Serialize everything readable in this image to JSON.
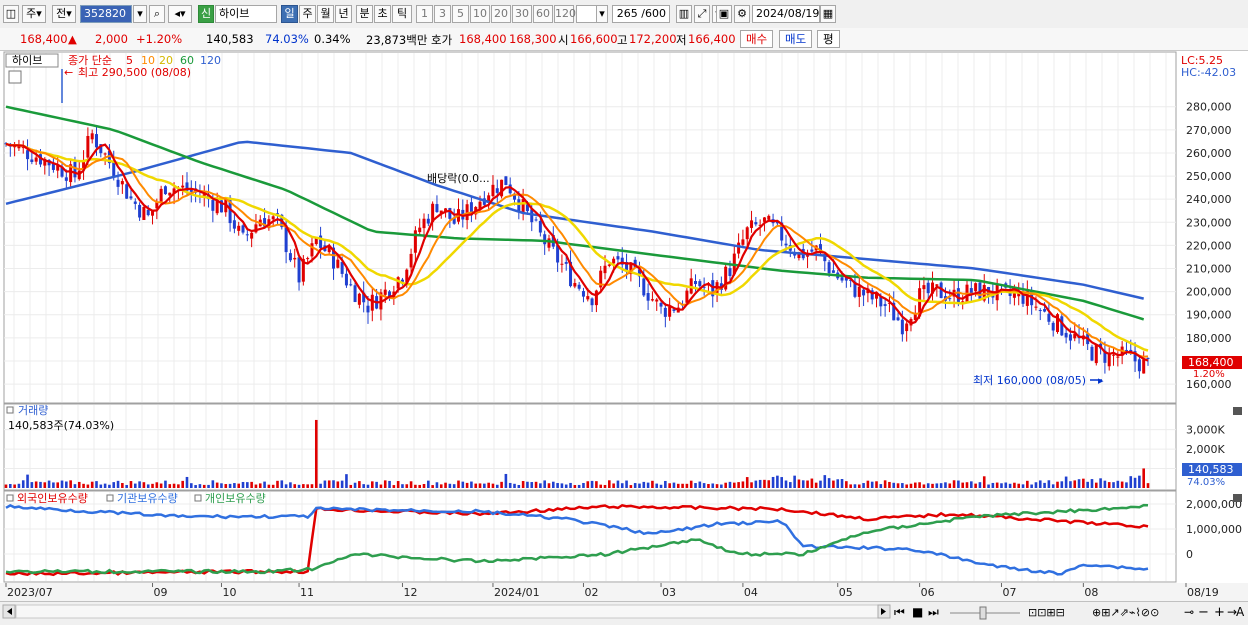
{
  "toolbar": {
    "period_main": "주",
    "code_label": "전",
    "stock_code": "352820",
    "name_badge": "신",
    "stock_name": "하이브",
    "periods": [
      "일",
      "주",
      "월",
      "년",
      "분",
      "초",
      "틱"
    ],
    "active_period": "일",
    "counts": [
      "1",
      "3",
      "5",
      "10",
      "20",
      "30",
      "60",
      "120"
    ],
    "range_text": "265 /600",
    "date": "2024/08/19"
  },
  "price_bar": {
    "price": "168,400",
    "change": "2,000",
    "change_pct": "+1.20%",
    "volume": "140,583",
    "volume_pct": "74.03%",
    "turnover_pct": "0.34%",
    "amount": "23,873백만",
    "hoga_label": "호가",
    "ask": "168,400",
    "bid": "168,300",
    "open_label": "시",
    "open": "166,600",
    "high_label": "고",
    "high": "172,200",
    "low_label": "저",
    "low": "166,400",
    "buy_label": "매수",
    "sell_label": "매도",
    "avg_label": "평"
  },
  "legend": {
    "name": "하이브",
    "ma_label": "종가 단순",
    "ma_periods": [
      "5",
      "10",
      "20",
      "60",
      "120"
    ],
    "ma_colors": [
      "#e00000",
      "#ff8a00",
      "#f0d800",
      "#1a9a3a",
      "#2f5fd0"
    ],
    "lc": "LC:5.25",
    "hc": "HC:-42.03"
  },
  "annotations": {
    "high_marker": "최고 290,500 (08/08)",
    "low_marker": "최저 160,000 (08/05)",
    "dividend": "배당락(0.0...",
    "current_tag": "168,400",
    "current_tag_pct": "1.20%"
  },
  "volume_panel": {
    "title": "거래량",
    "readout": "140,583주(74.03%)",
    "tag": "140,583",
    "tag_pct": "74.03%"
  },
  "holdings_panel": {
    "series": [
      "외국인보유수량",
      "기관보유수량",
      "개인보유수량"
    ],
    "colors": [
      "#e00000",
      "#3070e0",
      "#2e9e4e"
    ]
  },
  "chart_data": {
    "type": "candlestick",
    "price_axis": [
      "280,000",
      "270,000",
      "260,000",
      "250,000",
      "240,000",
      "230,000",
      "220,000",
      "210,000",
      "200,000",
      "190,000",
      "180,000",
      "170,000",
      "160,000"
    ],
    "price_ticks": [
      280000,
      270000,
      260000,
      250000,
      240000,
      230000,
      220000,
      210000,
      200000,
      190000,
      180000,
      170000,
      160000
    ],
    "ylim": [
      157000,
      292000
    ],
    "close_path": [
      [
        0,
        264000
      ],
      [
        8,
        258000
      ],
      [
        16,
        250000
      ],
      [
        20,
        268000
      ],
      [
        24,
        256000
      ],
      [
        29,
        240000
      ],
      [
        33,
        232000
      ],
      [
        37,
        246000
      ],
      [
        42,
        244000
      ],
      [
        47,
        240000
      ],
      [
        51,
        236000
      ],
      [
        55,
        222000
      ],
      [
        59,
        232000
      ],
      [
        63,
        230000
      ],
      [
        68,
        206000
      ],
      [
        72,
        222000
      ],
      [
        76,
        214000
      ],
      [
        80,
        202000
      ],
      [
        84,
        194000
      ],
      [
        88,
        200000
      ],
      [
        92,
        208000
      ],
      [
        96,
        228000
      ],
      [
        100,
        238000
      ],
      [
        104,
        230000
      ],
      [
        108,
        236000
      ],
      [
        112,
        244000
      ],
      [
        116,
        248000
      ],
      [
        120,
        236000
      ],
      [
        124,
        224000
      ],
      [
        128,
        214000
      ],
      [
        132,
        204000
      ],
      [
        136,
        198000
      ],
      [
        140,
        214000
      ],
      [
        144,
        210000
      ],
      [
        148,
        202000
      ],
      [
        152,
        192000
      ],
      [
        156,
        194000
      ],
      [
        160,
        204000
      ],
      [
        164,
        200000
      ],
      [
        168,
        210000
      ],
      [
        172,
        226000
      ],
      [
        176,
        230000
      ],
      [
        180,
        224000
      ],
      [
        184,
        216000
      ],
      [
        188,
        218000
      ],
      [
        192,
        208000
      ],
      [
        196,
        202000
      ],
      [
        200,
        198000
      ],
      [
        204,
        194000
      ],
      [
        208,
        186000
      ],
      [
        212,
        198000
      ],
      [
        216,
        200000
      ],
      [
        220,
        198000
      ],
      [
        224,
        200000
      ],
      [
        228,
        200000
      ],
      [
        232,
        198000
      ],
      [
        236,
        198000
      ],
      [
        240,
        192000
      ],
      [
        244,
        186000
      ],
      [
        248,
        180000
      ],
      [
        252,
        174000
      ],
      [
        256,
        172000
      ],
      [
        260,
        172000
      ],
      [
        264,
        168400
      ]
    ],
    "ma120_path": [
      [
        0,
        238000
      ],
      [
        30,
        252000
      ],
      [
        55,
        265000
      ],
      [
        80,
        260000
      ],
      [
        100,
        246000
      ],
      [
        120,
        234000
      ],
      [
        150,
        226000
      ],
      [
        175,
        218000
      ],
      [
        200,
        214000
      ],
      [
        225,
        210000
      ],
      [
        250,
        203000
      ],
      [
        264,
        197000
      ]
    ],
    "ma60_path": [
      [
        0,
        280000
      ],
      [
        25,
        270000
      ],
      [
        45,
        256000
      ],
      [
        65,
        244000
      ],
      [
        85,
        226000
      ],
      [
        105,
        223000
      ],
      [
        125,
        222000
      ],
      [
        150,
        216000
      ],
      [
        180,
        209000
      ],
      [
        200,
        206000
      ],
      [
        225,
        205000
      ],
      [
        250,
        196000
      ],
      [
        264,
        188000
      ]
    ],
    "price_axis_tag": "168,400",
    "volume_axis": [
      "3,000K",
      "2,000K",
      "1,000K"
    ],
    "volume_ticks": [
      3000000,
      2000000,
      1000000
    ],
    "holdings_axis": [
      "2,000,000",
      "1,000,000",
      "0"
    ],
    "holdings_ticks": [
      2000000,
      1000000,
      0
    ],
    "x_labels": [
      "2023/07",
      "09",
      "10",
      "11",
      "12",
      "2024/01",
      "02",
      "03",
      "04",
      "05",
      "06",
      "07",
      "08",
      "08/19"
    ],
    "x_positions": [
      0,
      34,
      50,
      68,
      92,
      113,
      134,
      152,
      171,
      193,
      212,
      231,
      250,
      264
    ]
  }
}
